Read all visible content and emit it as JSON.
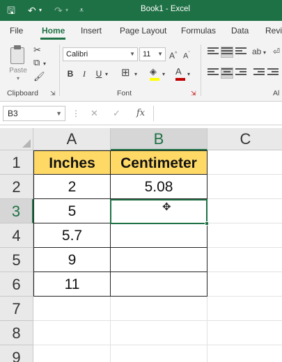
{
  "titlebar": {
    "title": "Book1  -  Excel",
    "bg": "#1e7145"
  },
  "tabs": [
    {
      "label": "File"
    },
    {
      "label": "Home",
      "active": true
    },
    {
      "label": "Insert"
    },
    {
      "label": "Page Layout"
    },
    {
      "label": "Formulas"
    },
    {
      "label": "Data"
    },
    {
      "label": "Revi"
    }
  ],
  "ribbon": {
    "clipboard": {
      "paste_label": "Paste",
      "group_label": "Clipboard"
    },
    "font": {
      "font_name": "Calibri",
      "font_size": "11",
      "group_label": "Font",
      "bold": "B",
      "italic": "I",
      "underline": "U",
      "fill_color": "#ffff00",
      "font_color": "#c00000"
    },
    "alignment": {
      "group_label": "Al"
    }
  },
  "formula_bar": {
    "name_box": "B3",
    "fx": "fx",
    "value": ""
  },
  "sheet": {
    "columns": [
      "A",
      "B",
      "C"
    ],
    "rows": [
      "1",
      "2",
      "3",
      "4",
      "5",
      "6",
      "7",
      "8",
      "9"
    ],
    "selected_cell": "B3",
    "header_fill": "#ffd966",
    "cells": {
      "A1": "Inches",
      "B1": "Centimeter",
      "A2": "2",
      "B2": "5.08",
      "A3": "5",
      "B3": "",
      "A4": "5.7",
      "B4": "",
      "A5": "9",
      "B5": "",
      "A6": "11",
      "B6": ""
    }
  }
}
